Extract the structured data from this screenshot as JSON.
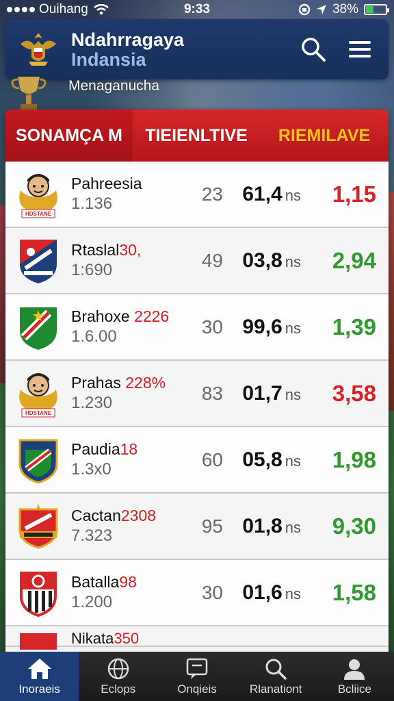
{
  "status_bar": {
    "carrier": "Ouihang",
    "time": "9:33",
    "battery": "38%",
    "battery_level": 0.38
  },
  "header": {
    "title": "Ndahrragaya",
    "subtitle": "Indansia"
  },
  "section_label": "Menaganucha",
  "tabs": [
    {
      "label": "SONAMÇA M"
    },
    {
      "label": "TIEIENLTIVE"
    },
    {
      "label": "RIEMILAVE"
    }
  ],
  "rows": [
    {
      "name": "Pahreesia",
      "tag": "",
      "sub": "1.136",
      "num": "23",
      "score": "61,4",
      "unit": "ns",
      "odds": "1,15",
      "odds_color": "red",
      "crest_label": "HDSTANE"
    },
    {
      "name": "Rtaslal",
      "tag": "30,",
      "sub": "1:690",
      "num": "49",
      "score": "03,8",
      "unit": "ns",
      "odds": "2,94",
      "odds_color": "green",
      "crest_label": ""
    },
    {
      "name": "Brahoxe ",
      "tag": "2226",
      "sub": "1.6.00",
      "num": "30",
      "score": "99,6",
      "unit": "ns",
      "odds": "1,39",
      "odds_color": "green",
      "crest_label": ""
    },
    {
      "name": "Prahas ",
      "tag": "228%",
      "sub": "1.230",
      "num": "83",
      "score": "01,7",
      "unit": "ns",
      "odds": "3,58",
      "odds_color": "red",
      "crest_label": "HDSTANE"
    },
    {
      "name": "Paudia",
      "tag": "18",
      "sub": "1.3x0",
      "num": "60",
      "score": "05,8",
      "unit": "ns",
      "odds": "1,98",
      "odds_color": "green",
      "crest_label": ""
    },
    {
      "name": "Cactan",
      "tag": "2308",
      "sub": "7.323",
      "num": "95",
      "score": "01,8",
      "unit": "ns",
      "odds": "9,30",
      "odds_color": "green",
      "crest_label": ""
    },
    {
      "name": "Batalla",
      "tag": "98",
      "sub": "1.200",
      "num": "30",
      "score": "01,6",
      "unit": "ns",
      "odds": "1,58",
      "odds_color": "green",
      "crest_label": ""
    }
  ],
  "peek_row": {
    "name": "Nikata",
    "tag": "350"
  },
  "nav": [
    {
      "label": "Inoraeis",
      "icon": "home-icon",
      "active": true
    },
    {
      "label": "Eclops",
      "icon": "globe-icon",
      "active": false
    },
    {
      "label": "Onqieis",
      "icon": "chat-icon",
      "active": false
    },
    {
      "label": "Rlanationt",
      "icon": "search-icon",
      "active": false
    },
    {
      "label": "Bcliice",
      "icon": "user-icon",
      "active": false
    }
  ],
  "colors": {
    "red": "#d5232a",
    "green": "#2f9a2f",
    "header_blue": "#1d3a6a",
    "tab_red": "#c21a20",
    "tab_yellow": "#f5c21b"
  }
}
